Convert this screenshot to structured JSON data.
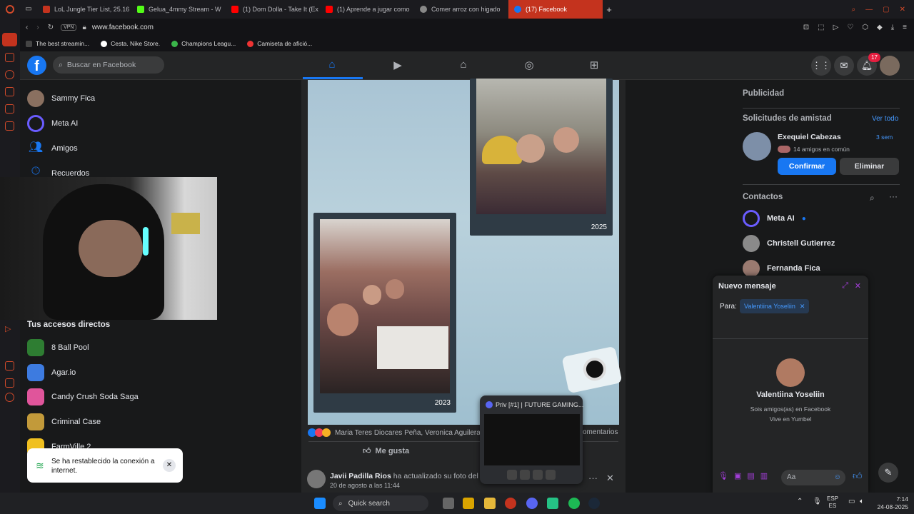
{
  "tabs": [
    {
      "label": "LoL Jungle Tier List, 25.16",
      "color": "#c4331e",
      "active": false
    },
    {
      "label": "Gelua_4mmy Stream - W",
      "color": "#53fc18",
      "active": false
    },
    {
      "label": "(1) Dom Dolla - Take It (Ex",
      "color": "#ff0000",
      "active": false
    },
    {
      "label": "(1) Aprende a jugar como",
      "color": "#ff0000",
      "active": false
    },
    {
      "label": "Comer arroz con higado",
      "color": "#888",
      "active": false
    },
    {
      "label": "(17) Facebook",
      "color": "#1877f2",
      "active": true
    }
  ],
  "url": {
    "vpn": "VPN",
    "address": "www.facebook.com"
  },
  "bookmarks": [
    "The best streamin...",
    "Cesta. Nike Store.",
    "Champions Leagu...",
    "Camiseta de afició..."
  ],
  "fb": {
    "logo": "f",
    "search_placeholder": "Buscar en Facebook",
    "notif_count": "17"
  },
  "leftnav": {
    "items": [
      {
        "label": "Sammy Fica"
      },
      {
        "label": "Meta AI"
      },
      {
        "label": "Amigos"
      },
      {
        "label": "Recuerdos"
      }
    ],
    "shortcuts_title": "Tus accesos directos",
    "shortcuts": [
      "8 Ball Pool",
      "Agar.io",
      "Candy Crush Soda Saga",
      "Criminal Case",
      "FarmVille 2"
    ]
  },
  "post": {
    "year_top": "2025",
    "year_bottom": "2023",
    "reactions": "Maria Teres Diocares Peña, Veronica Aguilera",
    "comments": "omentarios",
    "like": "Me gusta",
    "next_author": "Javii Padilla Rios",
    "next_action": "ha actualizado su foto del per",
    "next_date": "20 de agosto a las 11:44"
  },
  "right": {
    "ads": "Publicidad",
    "friend_requests": "Solicitudes de amistad",
    "see_all": "Ver todo",
    "requester": "Exequiel Cabezas",
    "req_time": "3 sem",
    "mutual": "14 amigos en común",
    "confirm": "Confirmar",
    "delete": "Eliminar",
    "contacts": "Contactos",
    "contact_list": [
      "Meta AI",
      "Christell Gutierrez",
      "Fernanda Fica"
    ]
  },
  "chat": {
    "title": "Nuevo mensaje",
    "to_label": "Para:",
    "recipient_chip": "Valentiina Yoseliin",
    "profile_name": "Valentiina Yoseliin",
    "profile_line1": "Sois amigos(as) en Facebook",
    "profile_line2": "Vive en Yumbel",
    "input_placeholder": "Aa"
  },
  "toast": {
    "text": "Se ha restablecido la conexión a internet."
  },
  "discord": {
    "title": "Priv [#1] | FUTURE GAMING..."
  },
  "taskbar": {
    "search": "Quick search",
    "lang1": "ESP",
    "lang2": "ES",
    "time": "7:14",
    "date": "24-08-2025"
  },
  "colors": {
    "fb_blue": "#1877f2",
    "opera_red": "#c4331e",
    "bg": "#18191a"
  }
}
